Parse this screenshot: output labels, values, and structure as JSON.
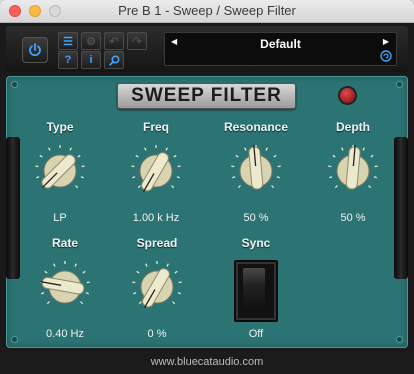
{
  "window": {
    "title": "Pre B 1 - Sweep / Sweep Filter"
  },
  "toolbar": {
    "preset_name": "Default",
    "buttons": [
      "power-icon",
      "menu-icon",
      "settings-icon",
      "undo-icon",
      "redo-icon",
      "help-icon",
      "info-icon",
      "search-icon"
    ]
  },
  "plugin": {
    "title": "SWEEP FILTER"
  },
  "params": {
    "type": {
      "label": "Type",
      "value": "LP"
    },
    "freq": {
      "label": "Freq",
      "value": "1.00 k Hz"
    },
    "resonance": {
      "label": "Resonance",
      "value": "50 %"
    },
    "depth": {
      "label": "Depth",
      "value": "50 %"
    },
    "rate": {
      "label": "Rate",
      "value": "0.40 Hz"
    },
    "spread": {
      "label": "Spread",
      "value": "0 %"
    },
    "sync": {
      "label": "Sync",
      "value": "Off"
    }
  },
  "knob_rotation_deg": {
    "type": -135,
    "freq": -150,
    "resonance": -5,
    "depth": 5,
    "rate": -80,
    "spread": -150
  },
  "footer": {
    "url": "www.bluecataudio.com"
  },
  "colors": {
    "accent": "#3ea2ff",
    "panel": "#2c7474",
    "led": "#c42020"
  }
}
